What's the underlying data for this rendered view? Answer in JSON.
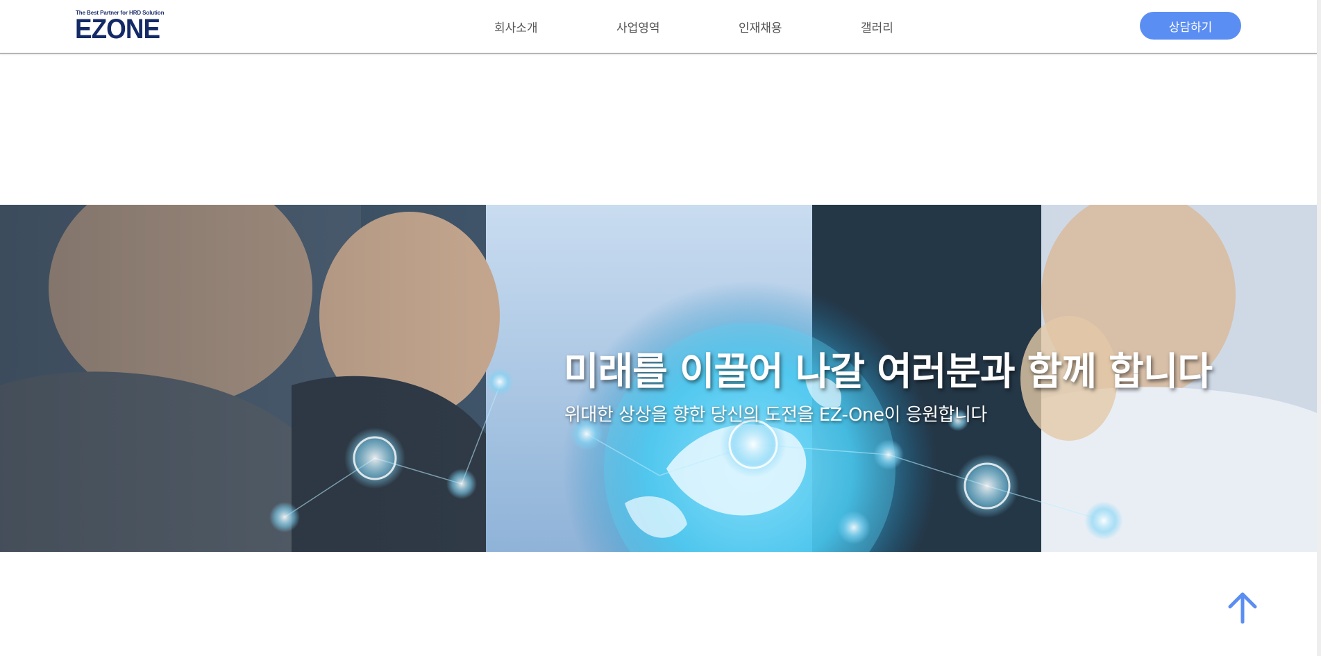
{
  "header": {
    "logo": {
      "tagline": "The Best Partner for HRD Solution",
      "wordmark": "EZONE"
    },
    "nav": [
      {
        "label": "회사소개"
      },
      {
        "label": "사업영역"
      },
      {
        "label": "인재채용"
      },
      {
        "label": "갤러리"
      }
    ],
    "cta_label": "상담하기"
  },
  "banner": {
    "title": "미래를 이끌어 나갈 여러분과 함께 합니다",
    "subtitle": "위대한 상상을 향한 당신의 도전을 EZ-One이 응원합니다",
    "image_description_icon": "global-network-people-photo"
  },
  "scroll_top": {
    "icon": "arrow-up-icon"
  },
  "colors": {
    "accent": "#5b8ef2",
    "logo_navy": "#142a66",
    "nav_text": "#555555",
    "header_border": "#b5b5b5"
  }
}
